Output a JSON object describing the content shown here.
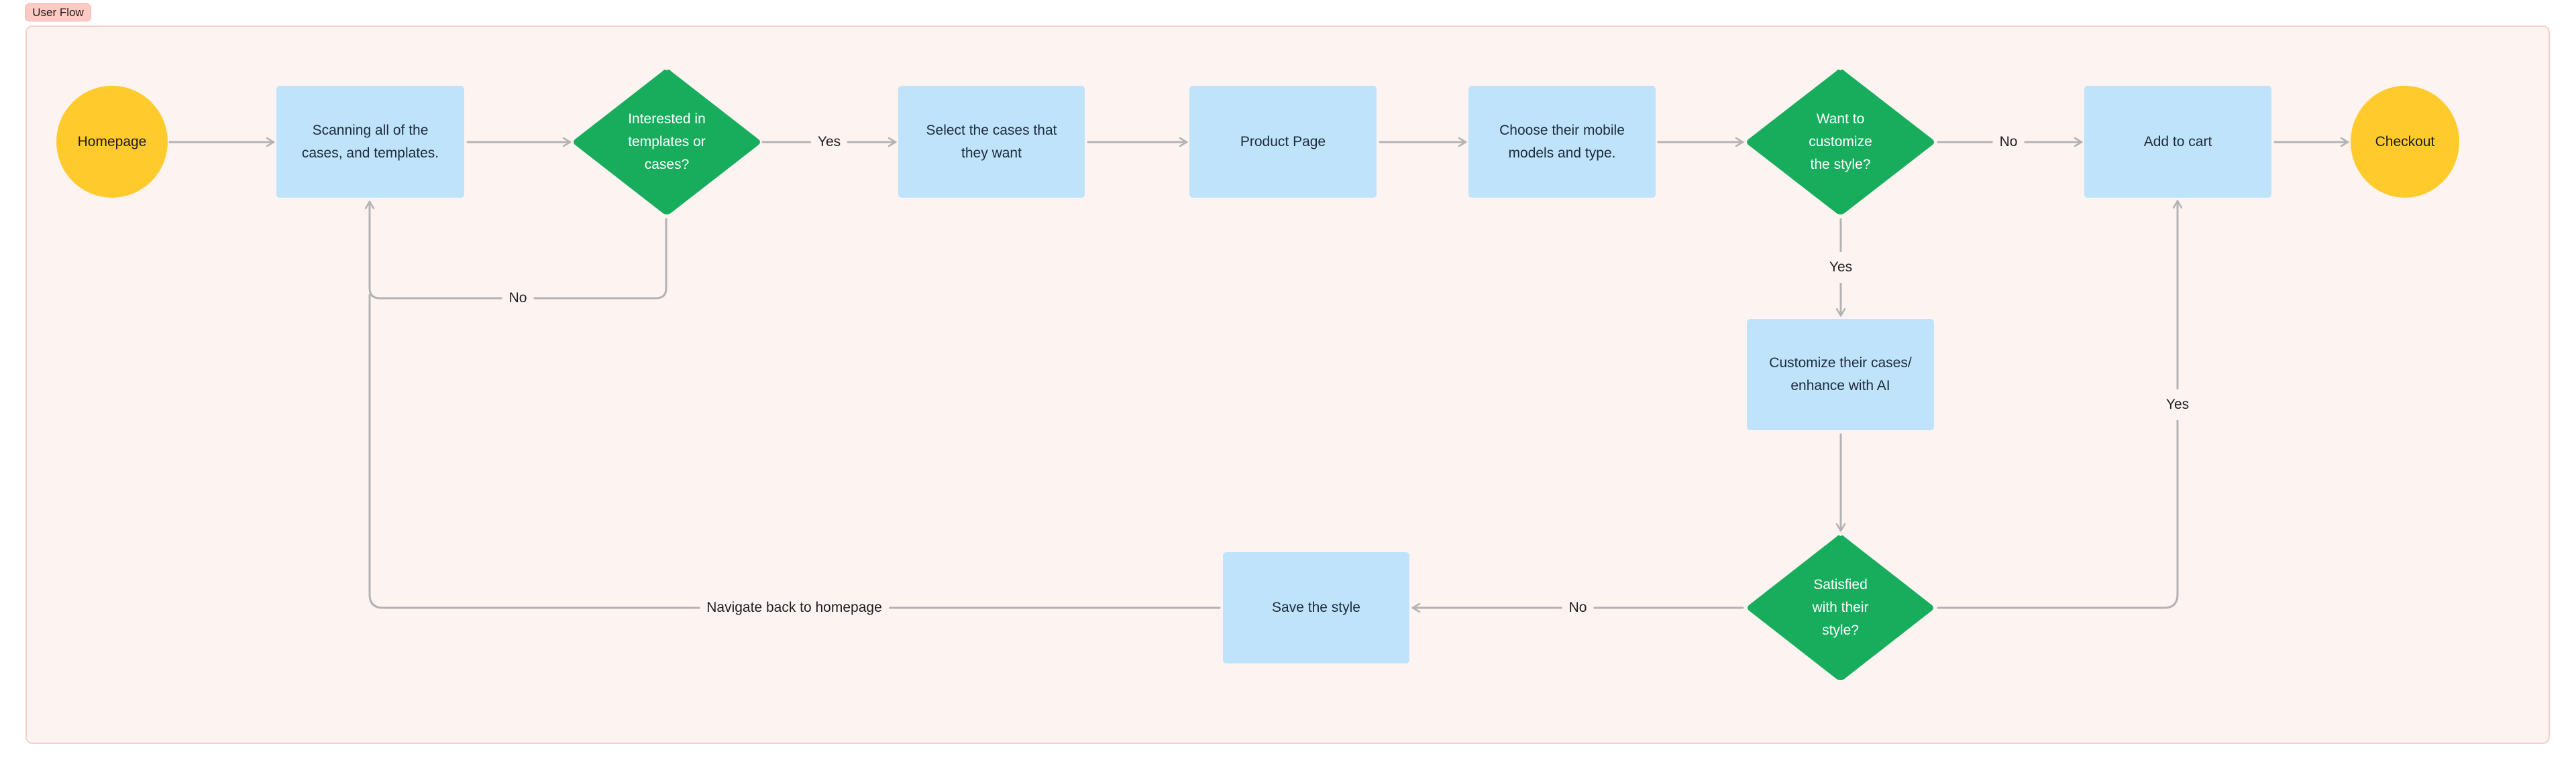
{
  "frame": {
    "title": "User Flow"
  },
  "colors": {
    "process": "#BEE3FB",
    "decision": "#17AD5C",
    "terminal": "#FFCA2C",
    "connector": "#B3B3B3",
    "frame_bg": "#FDF4F2"
  },
  "nodes": {
    "homepage": {
      "type": "terminal",
      "label": "Homepage"
    },
    "scanning": {
      "type": "process",
      "label": "Scanning all of the cases, and templates."
    },
    "interested": {
      "type": "decision",
      "label": "Interested in templates or cases?"
    },
    "select_cases": {
      "type": "process",
      "label": "Select the cases that they want"
    },
    "product_page": {
      "type": "process",
      "label": "Product Page"
    },
    "choose_models": {
      "type": "process",
      "label": "Choose their mobile models and type."
    },
    "want_customize": {
      "type": "decision",
      "label": "Want to customize the style?"
    },
    "add_to_cart": {
      "type": "process",
      "label": "Add to cart"
    },
    "checkout": {
      "type": "terminal",
      "label": "Checkout"
    },
    "customize": {
      "type": "process",
      "label": "Customize their cases/ enhance with AI"
    },
    "satisfied": {
      "type": "decision",
      "label": "Satisfied with their style?"
    },
    "save_style": {
      "type": "process",
      "label": "Save the style"
    }
  },
  "edges": [
    {
      "from": "homepage",
      "to": "scanning",
      "label": ""
    },
    {
      "from": "scanning",
      "to": "interested",
      "label": ""
    },
    {
      "from": "interested",
      "to": "select_cases",
      "label": "Yes"
    },
    {
      "from": "interested",
      "to": "scanning",
      "label": "No"
    },
    {
      "from": "select_cases",
      "to": "product_page",
      "label": ""
    },
    {
      "from": "product_page",
      "to": "choose_models",
      "label": ""
    },
    {
      "from": "choose_models",
      "to": "want_customize",
      "label": ""
    },
    {
      "from": "want_customize",
      "to": "add_to_cart",
      "label": "No"
    },
    {
      "from": "want_customize",
      "to": "customize",
      "label": "Yes"
    },
    {
      "from": "add_to_cart",
      "to": "checkout",
      "label": ""
    },
    {
      "from": "customize",
      "to": "satisfied",
      "label": ""
    },
    {
      "from": "satisfied",
      "to": "add_to_cart",
      "label": "Yes"
    },
    {
      "from": "satisfied",
      "to": "save_style",
      "label": "No"
    },
    {
      "from": "save_style",
      "to": "scanning",
      "label": "Navigate back to homepage"
    }
  ]
}
